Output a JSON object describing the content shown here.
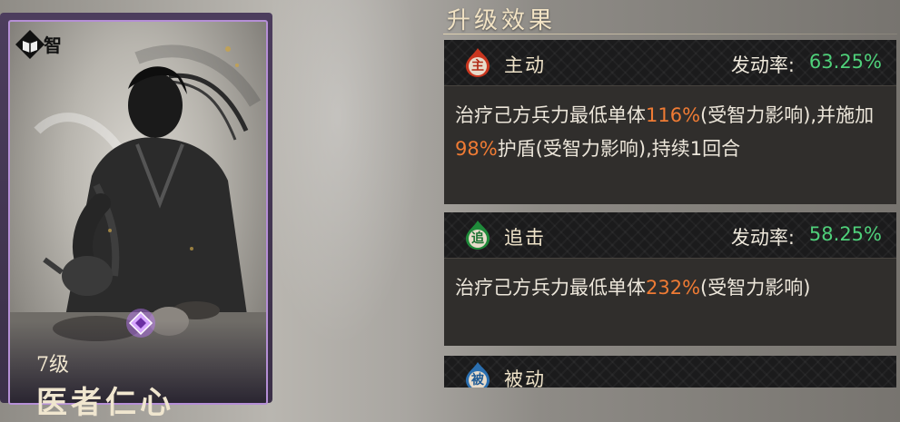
{
  "card": {
    "type_label": "智",
    "level": "7级",
    "name": "医者仁心"
  },
  "panel": {
    "section_title": "升级效果",
    "skills": [
      {
        "icon_char": "主",
        "type": "主动",
        "rate_label": "发动率:",
        "rate_value": "63.25%",
        "desc": {
          "p1": "治疗己方兵力最低单体",
          "v1": "116%",
          "p2": "(受智力影响),并施加",
          "v2": "98%",
          "p3": "护盾(受智力影响),持续1回合"
        }
      },
      {
        "icon_char": "追",
        "type": "追击",
        "rate_label": "发动率:",
        "rate_value": "58.25%",
        "desc": {
          "p1": "治疗己方兵力最低单体",
          "v1": "232%",
          "p2": "(受智力影响)"
        }
      },
      {
        "icon_char": "被",
        "type": "被动"
      }
    ]
  },
  "colors": {
    "active_icon": "#c9361f",
    "chase_icon": "#1f8a3a",
    "passive_icon": "#2b6fb0",
    "rate_value": "#4fd07a",
    "highlight": "#ef7b34"
  },
  "icons": {
    "type_badge": "book-icon",
    "gem": "purple-gem-icon",
    "active": "flame-active-icon",
    "chase": "flame-chase-icon",
    "passive": "flame-passive-icon"
  }
}
